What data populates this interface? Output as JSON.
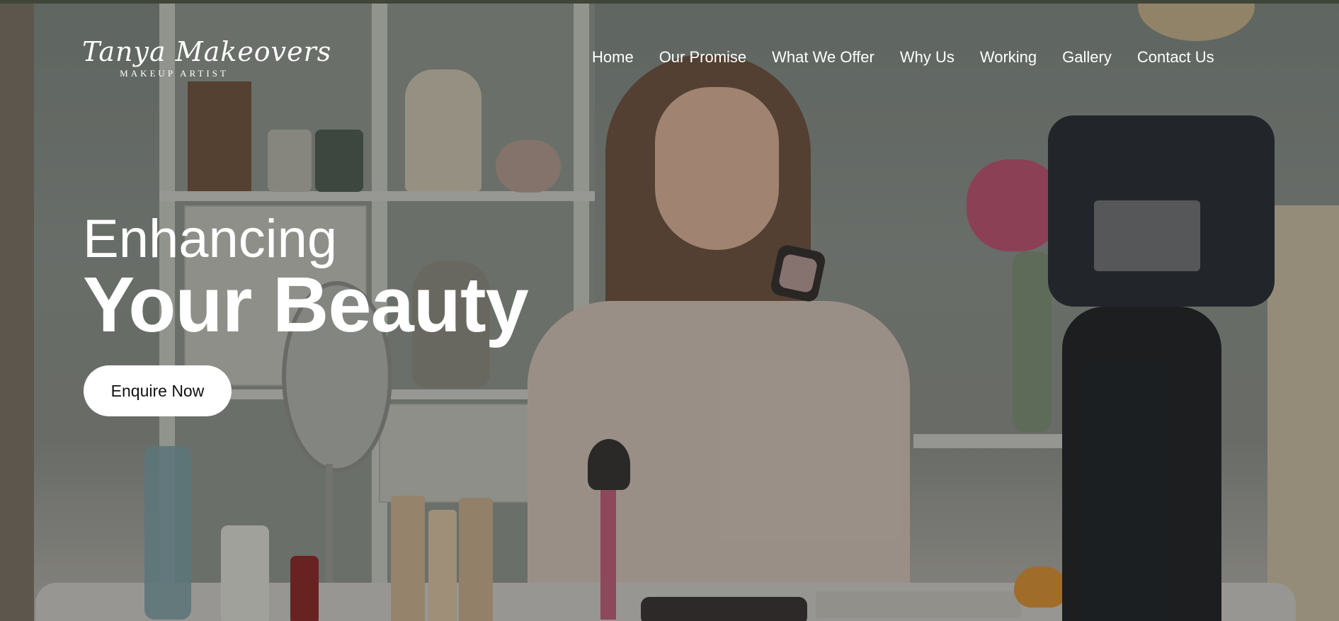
{
  "brand": {
    "name": "Tanya Makeovers",
    "tagline": "MAKEUP ARTIST"
  },
  "nav": {
    "items": [
      {
        "label": "Home"
      },
      {
        "label": "Our Promise"
      },
      {
        "label": "What We Offer"
      },
      {
        "label": "Why Us"
      },
      {
        "label": "Working"
      },
      {
        "label": "Gallery"
      },
      {
        "label": "Contact Us"
      }
    ]
  },
  "hero": {
    "line1": "Enhancing",
    "line2": "Your Beauty",
    "cta_label": "Enquire Now"
  },
  "colors": {
    "topbar": "#3f4539",
    "text": "#ffffff",
    "button_bg": "#ffffff",
    "button_text": "#111111"
  }
}
